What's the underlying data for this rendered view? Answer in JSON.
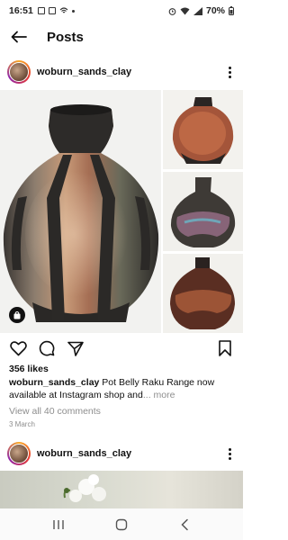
{
  "status": {
    "time": "16:51",
    "battery": "70%",
    "icons": [
      "image-icon",
      "mail-icon",
      "wifi-calling-icon",
      "notification-dot"
    ],
    "right_icons": [
      "alarm-icon",
      "wifi-icon",
      "signal-icon",
      "battery-icon"
    ]
  },
  "header": {
    "title": "Posts"
  },
  "post": {
    "username": "woburn_sands_clay",
    "likes": "356 likes",
    "caption_user": "woburn_sands_clay",
    "caption_text": " Pot Belly Raku Range now available at Instagram shop and",
    "caption_more": "... more",
    "comments_link": "View all 40 comments",
    "date": "3 March"
  },
  "next_post": {
    "username": "woburn_sands_clay"
  },
  "colors": {
    "text": "#111111",
    "muted": "#8e8e8e",
    "background": "#ffffff"
  }
}
